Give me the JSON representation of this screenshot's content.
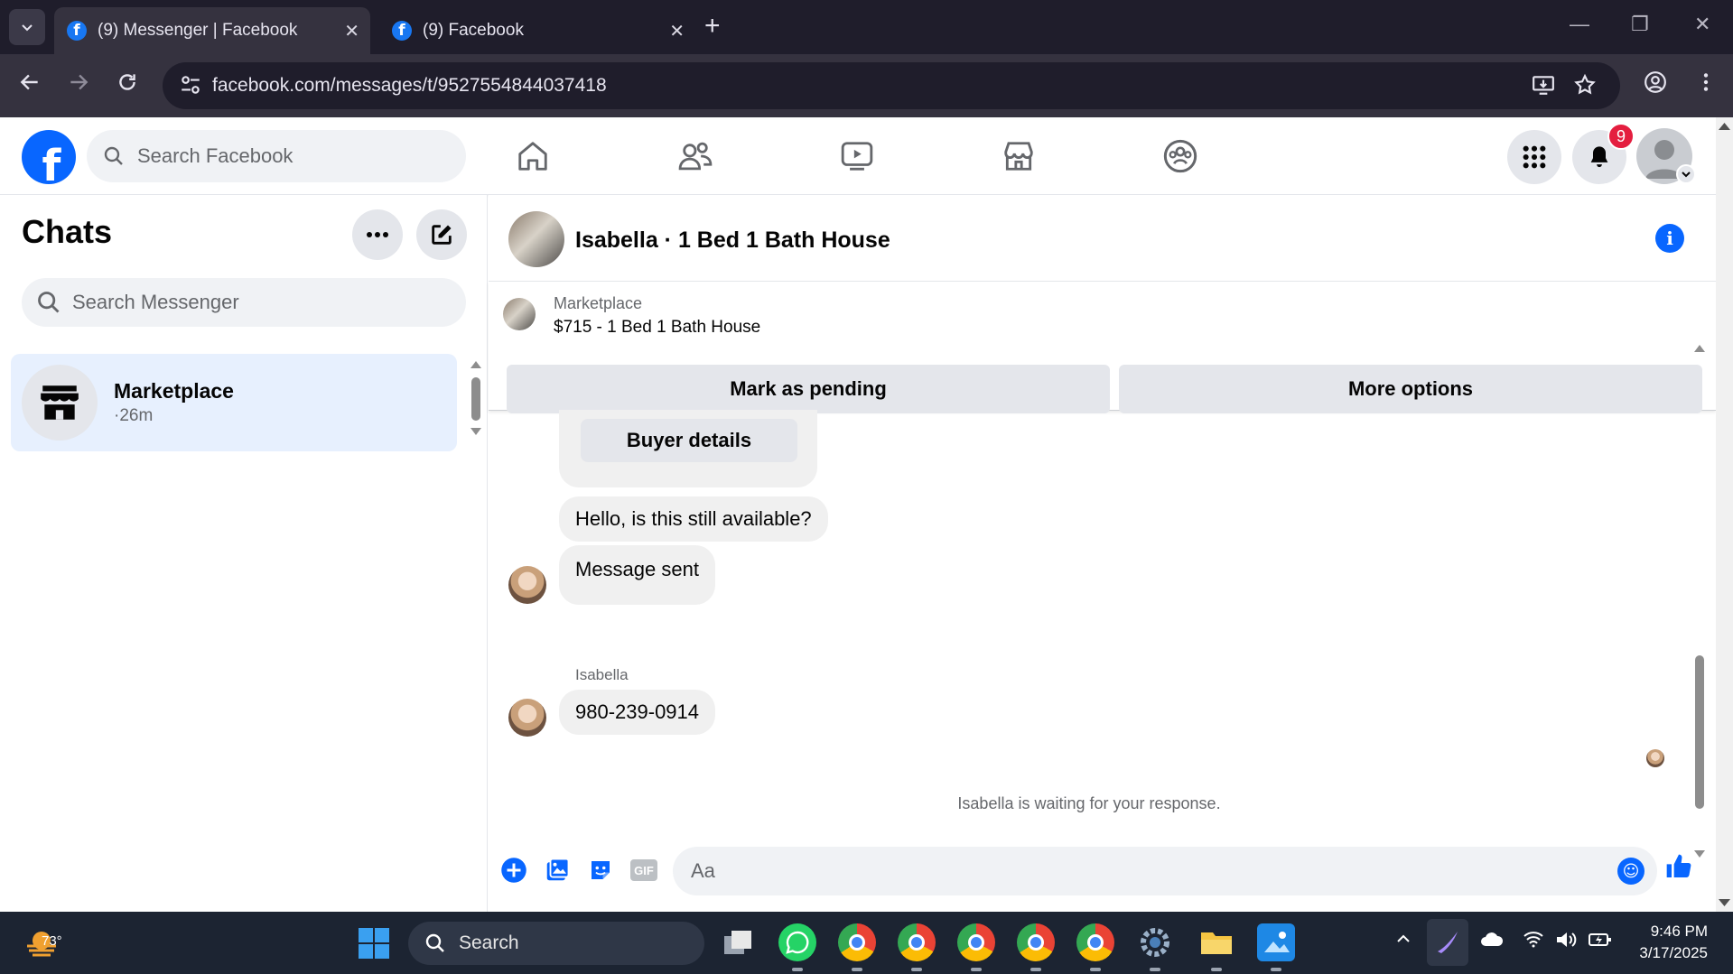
{
  "browser": {
    "tabs": [
      {
        "title": "(9) Messenger | Facebook",
        "active": true
      },
      {
        "title": "(9) Facebook",
        "active": false
      }
    ],
    "url": "facebook.com/messages/t/9527554844037418"
  },
  "header": {
    "search_placeholder": "Search Facebook",
    "notification_count": "9",
    "nav_icons": [
      "home-icon",
      "friends-icon",
      "video-icon",
      "marketplace-icon",
      "groups-icon"
    ],
    "accent": "#0866ff"
  },
  "chats": {
    "title": "Chats",
    "search_placeholder": "Search Messenger",
    "items": [
      {
        "name": "Marketplace",
        "time": "·26m"
      }
    ]
  },
  "conversation": {
    "title": "Isabella · 1 Bed 1 Bath House",
    "listing": {
      "source": "Marketplace",
      "title": "$715 - 1 Bed 1 Bath House",
      "mark_pending": "Mark as pending",
      "more_options": "More options"
    },
    "buyer_details": "Buyer details",
    "messages": [
      {
        "text": "Hello, is this still available?"
      },
      {
        "text": "Message sent"
      },
      {
        "sender": "Isabella",
        "text": "980-239-0914"
      }
    ],
    "waiting_text": "Isabella is waiting for your response.",
    "composer_placeholder": "Aa"
  },
  "taskbar": {
    "temperature": "73°",
    "search_placeholder": "Search",
    "time": "9:46 PM",
    "date": "3/17/2025"
  }
}
